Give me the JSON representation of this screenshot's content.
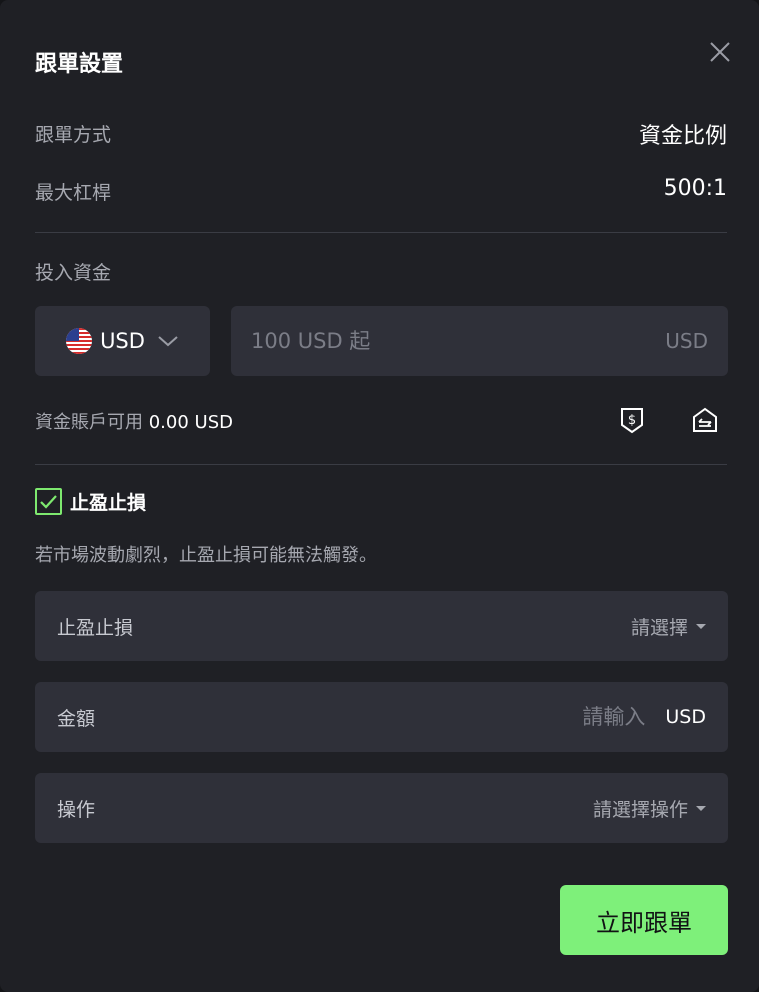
{
  "modal": {
    "title": "跟單設置",
    "close_icon": "close-icon"
  },
  "info": {
    "method_label": "跟單方式",
    "method_value": "資金比例",
    "leverage_label": "最大杠桿",
    "leverage_value": "500:1"
  },
  "investment": {
    "label": "投入資金",
    "currency": "USD",
    "flag_icon": "us-flag-icon",
    "amount_placeholder": "100 USD 起",
    "amount_unit": "USD",
    "available_label": "資金賬戶可用",
    "available_value": "0.00 USD"
  },
  "tp_sl": {
    "checkbox_label": "止盈止損",
    "checked": true,
    "warning": "若市場波動劇烈，止盈止損可能無法觸發。",
    "type_label": "止盈止損",
    "type_placeholder": "請選擇",
    "amount_label": "金額",
    "amount_placeholder": "請輸入",
    "amount_unit": "USD",
    "action_label": "操作",
    "action_placeholder": "請選擇操作"
  },
  "submit_label": "立即跟單",
  "colors": {
    "accent": "#7ef07a",
    "background": "#1f2025",
    "field": "#2f3039"
  }
}
